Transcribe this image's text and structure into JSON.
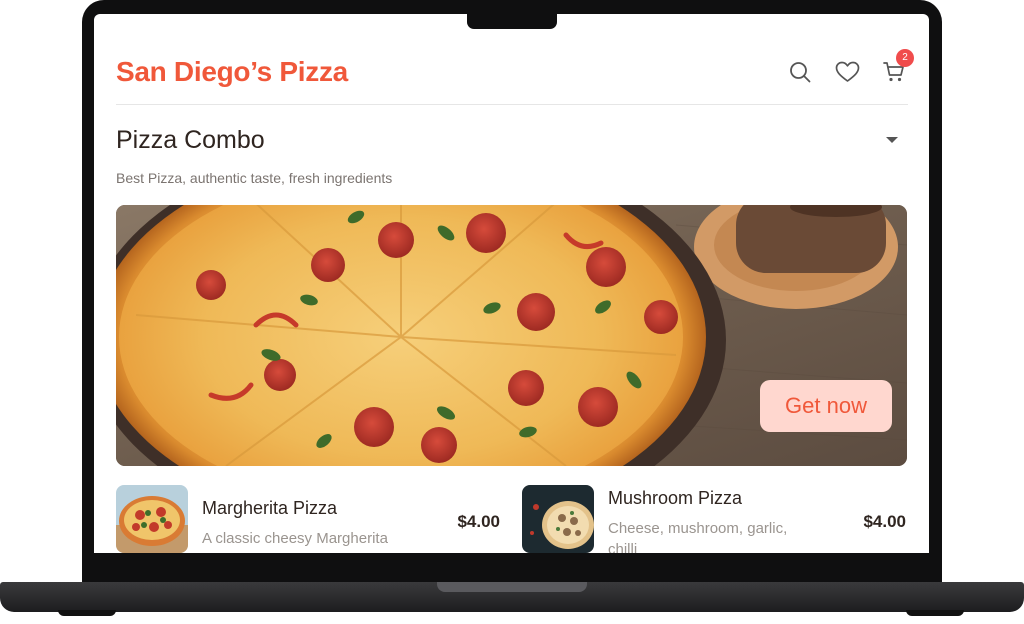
{
  "header": {
    "brand": "San Diego’s Pizza",
    "cart_badge": "2",
    "icons": [
      "search-icon",
      "heart-icon",
      "cart-icon"
    ]
  },
  "section": {
    "title": "Pizza Combo",
    "subtitle": "Best Pizza, authentic taste, fresh ingredients"
  },
  "hero": {
    "cta_label": "Get now"
  },
  "products": [
    {
      "name": "Margherita Pizza",
      "description": "A classic cheesy Margherita",
      "price": "$4.00"
    },
    {
      "name": "Mushroom Pizza",
      "description": "Cheese, mushroom, garlic, chilli",
      "price": "$4.00"
    }
  ],
  "colors": {
    "accent": "#f0583a",
    "cta_bg": "#ffd7cf",
    "badge": "#f04c4c",
    "text_dark": "#2f2520",
    "text_muted": "#9a948f"
  }
}
